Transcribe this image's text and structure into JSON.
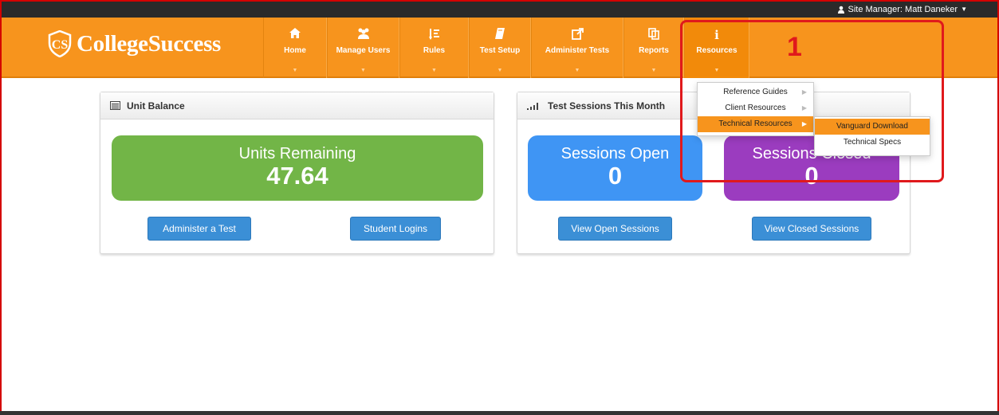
{
  "topbar": {
    "user_label": "Site Manager:  Matt Daneker"
  },
  "brand": {
    "name": "CollegeSuccess"
  },
  "nav": {
    "items": [
      {
        "label": "Home",
        "icon": "home-icon"
      },
      {
        "label": "Manage Users",
        "icon": "users-icon"
      },
      {
        "label": "Rules",
        "icon": "rules-icon"
      },
      {
        "label": "Test Setup",
        "icon": "book-icon"
      },
      {
        "label": "Administer Tests",
        "icon": "external-link-icon"
      },
      {
        "label": "Reports",
        "icon": "copy-icon"
      },
      {
        "label": "Resources",
        "icon": "info-icon"
      }
    ]
  },
  "resources_menu": {
    "items": [
      "Reference Guides",
      "Client Resources",
      "Technical Resources"
    ],
    "submenu": [
      "Vanguard Download",
      "Technical Specs"
    ]
  },
  "unit_balance": {
    "title": "Unit Balance",
    "stat_label": "Units Remaining",
    "stat_value": "47.64",
    "buttons": [
      "Administer a Test",
      "Student Logins"
    ]
  },
  "sessions": {
    "title": "Test Sessions This Month",
    "open_label": "Sessions Open",
    "open_value": "0",
    "closed_label": "Sessions Closed",
    "closed_value": "0",
    "buttons": [
      "View Open Sessions",
      "View Closed Sessions"
    ]
  },
  "annotation": {
    "step": "1"
  },
  "colors": {
    "nav_orange": "#f7941d",
    "green": "#72b547",
    "blue": "#3f95f4",
    "purple": "#9b3cbf",
    "button_blue": "#3b8fd6",
    "annotation_red": "#e0191c"
  }
}
